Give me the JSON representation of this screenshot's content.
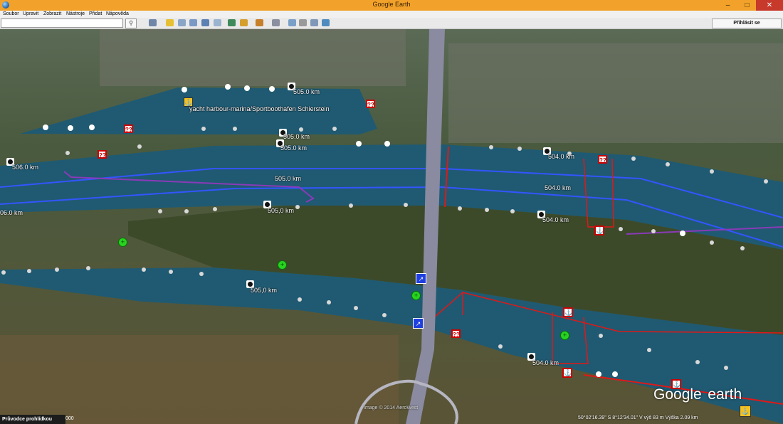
{
  "window": {
    "title": "Google Earth",
    "minimize": "–",
    "maximize": "□",
    "close": "✕"
  },
  "menu": [
    "Soubor",
    "Upravit",
    "Zobrazit",
    "Nástroje",
    "Přidat",
    "Nápověda"
  ],
  "toolbar": {
    "search_value": "",
    "search_icon": "search-icon",
    "signin_label": "Přihlásit se"
  },
  "map": {
    "labels": {
      "km_506_0": "506.0 km",
      "km_506_0_b": "06.0 km",
      "km_505_0_top": "505.0 km",
      "km_505_0_a": "505.0 km",
      "km_505_0_b": "505.0 km",
      "km_505_0_mid": "505.0 km",
      "km_505_0_island": "505,0 km",
      "km_505_0_lower": "505,0 km",
      "km_504_0_top": "504.0 km",
      "km_504_0_a": "504.0 km",
      "km_504_0_b": "504.0 km",
      "km_504_0_lower": "504.0 km",
      "marina": "yacht harbour-marina/Sportboothafen Schierstein",
      "question": "??",
      "anchor": "⚓"
    },
    "colors": {
      "river": "#1f5a72",
      "bank_line": "#3355ff",
      "red_line": "#e01818",
      "purple_line": "#8a3ab8"
    },
    "credit": "Image © 2014 AeroWest",
    "status_coords": "50°02'16.39\" S   8°12'34.01\" V   výš  83 m   Výška    2.09 km",
    "logo_main": "Google",
    "logo_suffix": "earth",
    "tour_guide": "Průvodce prohlídkou",
    "tour_num": "000"
  }
}
